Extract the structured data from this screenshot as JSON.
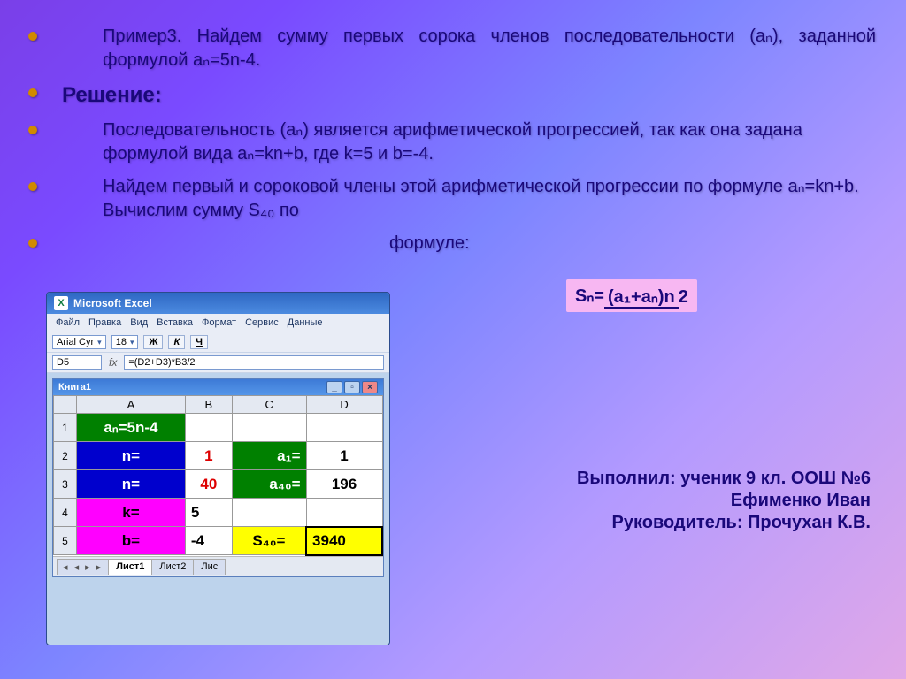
{
  "bullets": {
    "b1": "Пример3. Найдем сумму первых сорока членов последовательности (aₙ), заданной формулой aₙ=5n-4.",
    "b2": "Решение:",
    "b3": "Последовательность (aₙ) является арифметической прогрессией, так как она задана формулой вида aₙ=kn+b, где k=5 и b=-4.",
    "b4": "Найдем первый и сороковой члены этой арифметической прогрессии по формуле aₙ=kn+b. Вычислим сумму S₄₀ по",
    "b5": "формуле:"
  },
  "formula": {
    "lhs": "Sₙ=",
    "num": "(a₁+aₙ)n",
    "den": "2"
  },
  "credits": {
    "l1": "Выполнил: ученик 9 кл. ООШ №6",
    "l2": "Ефименко Иван",
    "l3": "Руководитель: Прочухан К.В."
  },
  "excel": {
    "title": "Microsoft Excel",
    "menu": [
      "Файл",
      "Правка",
      "Вид",
      "Вставка",
      "Формат",
      "Сервис",
      "Данные"
    ],
    "font": "Arial Cyr",
    "font_size": "18",
    "bold": "Ж",
    "italic": "К",
    "underline": "Ч",
    "name_box": "D5",
    "formula_bar": "=(D2+D3)*B3/2",
    "wb_title": "Книга1",
    "cols": [
      "",
      "A",
      "B",
      "C",
      "D"
    ],
    "rows": {
      "r1": {
        "A": "aₙ=5n-4",
        "B": "",
        "C": "",
        "D": ""
      },
      "r2": {
        "A": "n=",
        "B": "1",
        "C": "a₁=",
        "D": "1"
      },
      "r3": {
        "A": "n=",
        "B": "40",
        "C": "a₄₀=",
        "D": "196"
      },
      "r4": {
        "A": "k=",
        "B": "5",
        "C": "",
        "D": ""
      },
      "r5": {
        "A": "b=",
        "B": "-4",
        "C": "S₄₀=",
        "D": "3940"
      }
    },
    "tabs": {
      "t1": "Лист1",
      "t2": "Лист2",
      "t3": "Лис"
    }
  },
  "chart_data": {
    "type": "table",
    "title": "Сумма первых 40 членов aₙ=5n-4",
    "parameters": {
      "k": 5,
      "b": -4,
      "n_first": 1,
      "n_last": 40,
      "a1": 1,
      "a40": 196
    },
    "result": {
      "S40": 3940
    },
    "formula": "Sₙ = (a₁ + aₙ) · n / 2"
  }
}
